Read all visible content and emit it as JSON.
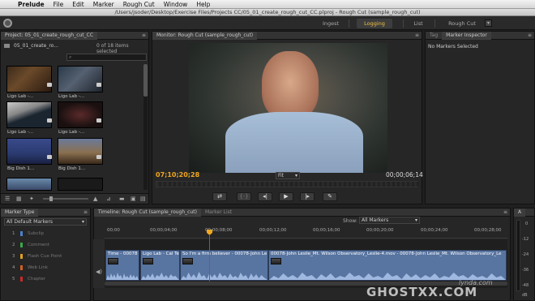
{
  "menubar": {
    "apple": "",
    "app": "Prelude",
    "items": [
      "File",
      "Edit",
      "Marker",
      "Rough Cut",
      "Window",
      "Help"
    ]
  },
  "titlebar": {
    "text": "/Users/jsoder/Desktop/Exercise Files/Projects CC/05_01_create_rough_cut_CC.plproj - Rough Cut (sample_rough_cut)"
  },
  "workspaces": {
    "ingest": "Ingest",
    "logging": "Logging",
    "list": "List",
    "roughcut": "Rough Cut"
  },
  "project": {
    "tab": "Project: 05_01_create_rough_cut_CC",
    "folder_name": "05_01_create_ro...",
    "count": "0 of 18 items selected",
    "search_placeholder": "",
    "items": [
      {
        "label": "Ligo Lab -..."
      },
      {
        "label": "Ligo Lab -..."
      },
      {
        "label": "Ligo Lab -..."
      },
      {
        "label": "Ligo Lab -..."
      },
      {
        "label": "Big Dish 1..."
      },
      {
        "label": "Big Dish 1..."
      }
    ]
  },
  "monitor": {
    "tab": "Monitor: Rough Cut (sample_rough_cut)",
    "timecode_current": "07;10;20;28",
    "fit": "Fit",
    "timecode_duration": "00;00;06;14"
  },
  "inspector": {
    "tab_tag": "Tag",
    "tab_marker": "Marker Inspector",
    "status": "No Markers Selected"
  },
  "marker_type": {
    "tab": "Marker Type",
    "dropdown": "All Default Markers",
    "items": [
      {
        "num": "1",
        "label": "Subclip",
        "color": "#4a80d0"
      },
      {
        "num": "2",
        "label": "Comment",
        "color": "#3ba84a"
      },
      {
        "num": "3",
        "label": "Flash Cue Point",
        "color": "#e0a020"
      },
      {
        "num": "4",
        "label": "Web Link",
        "color": "#d06020"
      },
      {
        "num": "5",
        "label": "Chapter",
        "color": "#c82a2a"
      }
    ]
  },
  "timeline": {
    "tab": "Timeline: Rough Cut (sample_rough_cut)",
    "tab2": "Marker List",
    "show_label": "Show:",
    "show_value": "All Markers",
    "ruler": [
      "00;00",
      "00;00;04;00",
      "00;00;08;00",
      "00;00;12;00",
      "00;00;16;00",
      "00;00;20;00",
      "00;00;24;00",
      "00;00;28;00"
    ],
    "clips": [
      {
        "title": "Time - 00078"
      },
      {
        "title": "Ligo Lab - Cal Te"
      },
      {
        "title": "So I'm a firm believer - 00078-John Le"
      },
      {
        "title": "00078-John Leslie_Mt. Wilson Observatory_Leslie-4.mov - 00078-John Leslie_Mt. Wilson Observatory_Le"
      }
    ]
  },
  "audio_meter": {
    "tab": "A",
    "ticks": [
      "0",
      "-12",
      "-24",
      "-36",
      "-48"
    ],
    "label": "dB"
  },
  "watermark": {
    "text": "GHOSTXX.COM",
    "sub": "lynda.com"
  }
}
